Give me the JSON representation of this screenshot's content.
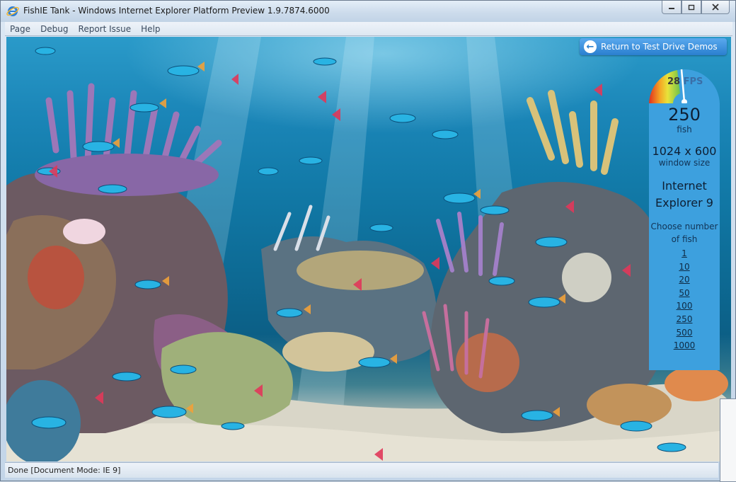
{
  "window": {
    "title": "FishIE Tank - Windows Internet Explorer Platform Preview 1.9.7874.6000",
    "controls": [
      "minimize-icon",
      "restore-icon",
      "close-icon"
    ]
  },
  "menu": {
    "items": [
      "Page",
      "Debug",
      "Report Issue",
      "Help"
    ]
  },
  "demo_button": {
    "label": "Return to Test Drive Demos"
  },
  "stats": {
    "fps_value": "28",
    "fps_unit": "FPS",
    "fish_count": "250",
    "fish_label": "fish",
    "window_size": "1024 x 600",
    "window_size_label": "window size",
    "browser_line1": "Internet",
    "browser_line2": "Explorer 9",
    "choose_line1": "Choose number",
    "choose_line2": "of fish",
    "fish_options": [
      "1",
      "10",
      "20",
      "50",
      "100",
      "250",
      "500",
      "1000"
    ]
  },
  "status": {
    "text": "Done [Document Mode: IE 9]"
  },
  "colors": {
    "panel": "#3da0de",
    "water": "#127aa8",
    "sand": "#d7d5c8"
  }
}
